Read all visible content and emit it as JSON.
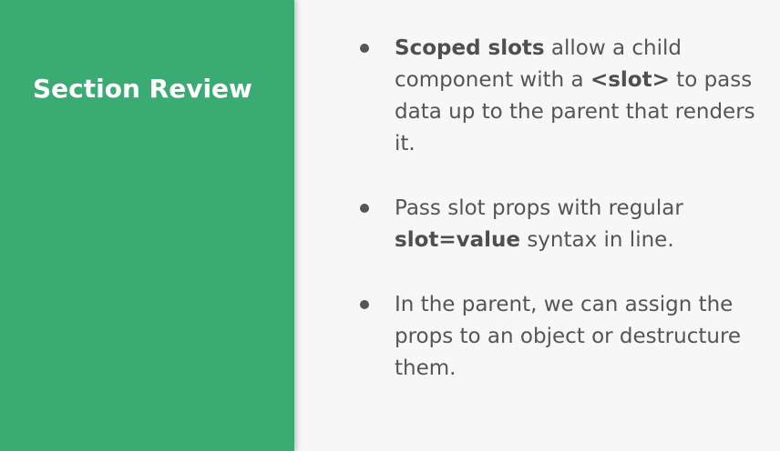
{
  "sidebar": {
    "title": "Section Review",
    "color": "#3aab72"
  },
  "bullets": [
    {
      "bold_lead": "Scoped slots",
      "text_1": " allow a child component with a ",
      "bold_mid": "<slot>",
      "text_2": " to pass data up to the parent that renders it."
    },
    {
      "text_1": "Pass slot props with regular ",
      "bold_mid": "slot=value",
      "text_2": " syntax in line."
    },
    {
      "text_1": "In the parent, we can assign the props to an object or destructure them."
    }
  ]
}
